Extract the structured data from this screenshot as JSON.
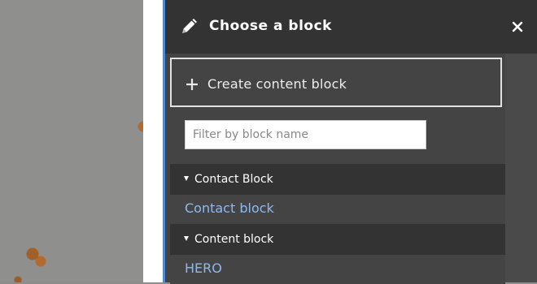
{
  "dialog": {
    "title": "Choose a block",
    "title_icon": "pencil-icon",
    "close_icon": "close-icon"
  },
  "create_button": {
    "label": "Create content block",
    "icon": "plus-icon"
  },
  "filter": {
    "placeholder": "Filter by block name",
    "value": ""
  },
  "categories": [
    {
      "label": "Contact Block",
      "expanded": true,
      "items": [
        {
          "label": "Contact block"
        }
      ]
    },
    {
      "label": "Content block",
      "expanded": true,
      "items": [
        {
          "label": "HERO"
        }
      ]
    }
  ],
  "colors": {
    "header": "#333333",
    "panel": "#444444",
    "link": "#8fb9ee",
    "accent_line": "#4d8ad1"
  }
}
